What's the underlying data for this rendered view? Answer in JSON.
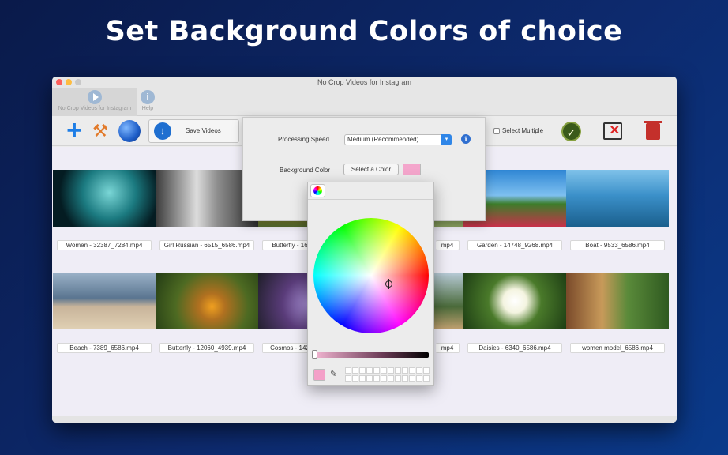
{
  "headline": "Set Background Colors of choice",
  "window": {
    "title": "No Crop Videos for Instagram"
  },
  "tabs": [
    {
      "label": "No Crop Videos for Instagram"
    },
    {
      "label": "Help"
    }
  ],
  "toolbar": {
    "save_label": "Save Videos",
    "select_multiple_label": "Select Multiple"
  },
  "settings": {
    "processing_speed_label": "Processing Speed",
    "processing_speed_value": "Medium (Recommended)",
    "background_color_label": "Background Color",
    "select_color_button": "Select a Color",
    "selected_color": "#f4a6cc"
  },
  "videos": [
    {
      "caption": "Women - 32387_7284.mp4"
    },
    {
      "caption": "Girl Russian - 6515_6586.mp4"
    },
    {
      "caption": "Butterfly - 16"
    },
    {
      "caption": "Garden - 14748_9268.mp4"
    },
    {
      "caption": "Boat - 9533_6586.mp4"
    },
    {
      "caption": "Beach - 7389_6586.mp4"
    },
    {
      "caption": "Butterfly - 12060_4939.mp4"
    },
    {
      "caption": "Cosmos - 142"
    },
    {
      "caption": "Daisies - 6340_6586.mp4"
    },
    {
      "caption": "women model_6586.mp4"
    }
  ],
  "partial_captions": {
    "row1_right_fragment": "mp4",
    "row2_right_fragment": "mp4"
  },
  "colors": {
    "accent": "#2f86e8",
    "background_top": "#0a1a4a",
    "background_bottom": "#0a3a8a"
  }
}
